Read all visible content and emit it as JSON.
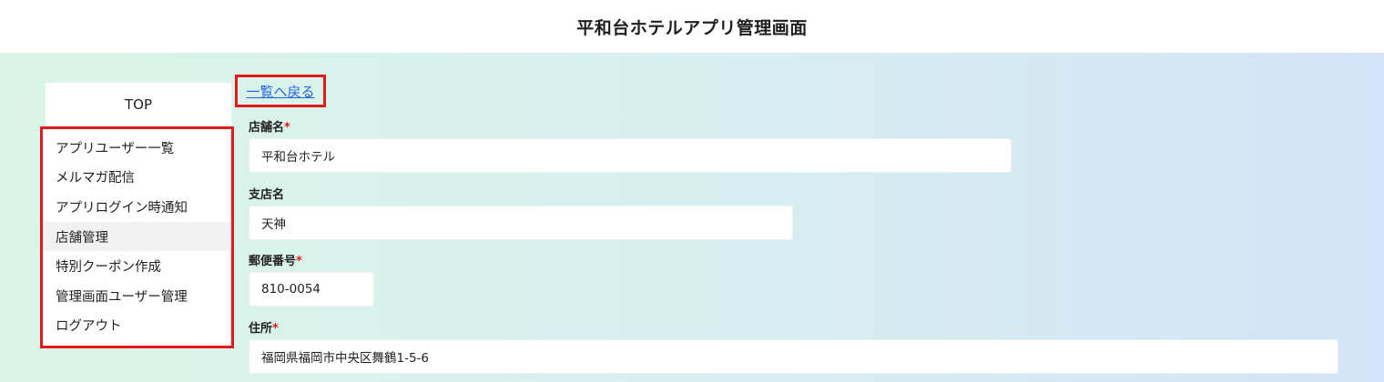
{
  "header": {
    "title": "平和台ホテルアプリ管理画面"
  },
  "sidebar": {
    "top_label": "TOP",
    "items": [
      {
        "label": "アプリユーザー一覧"
      },
      {
        "label": "メルマガ配信"
      },
      {
        "label": "アプリログイン時通知"
      },
      {
        "label": "店舗管理"
      },
      {
        "label": "特別クーポン作成"
      },
      {
        "label": "管理画面ユーザー管理"
      },
      {
        "label": "ログアウト"
      }
    ],
    "active_item": "店舗管理"
  },
  "main": {
    "back_link": "一覧へ戻る",
    "fields": {
      "store_name": {
        "label": "店舗名",
        "required": "*",
        "value": "平和台ホテル"
      },
      "branch_name": {
        "label": "支店名",
        "value": "天神"
      },
      "postal_code": {
        "label": "郵便番号",
        "required": "*",
        "value": "810-0054"
      },
      "address": {
        "label": "住所",
        "required": "*",
        "value": "福岡県福岡市中央区舞鶴1-5-6"
      }
    }
  },
  "colors": {
    "highlight_border": "#e01b1b",
    "link": "#2166d6",
    "required_mark": "#e01b1b"
  }
}
